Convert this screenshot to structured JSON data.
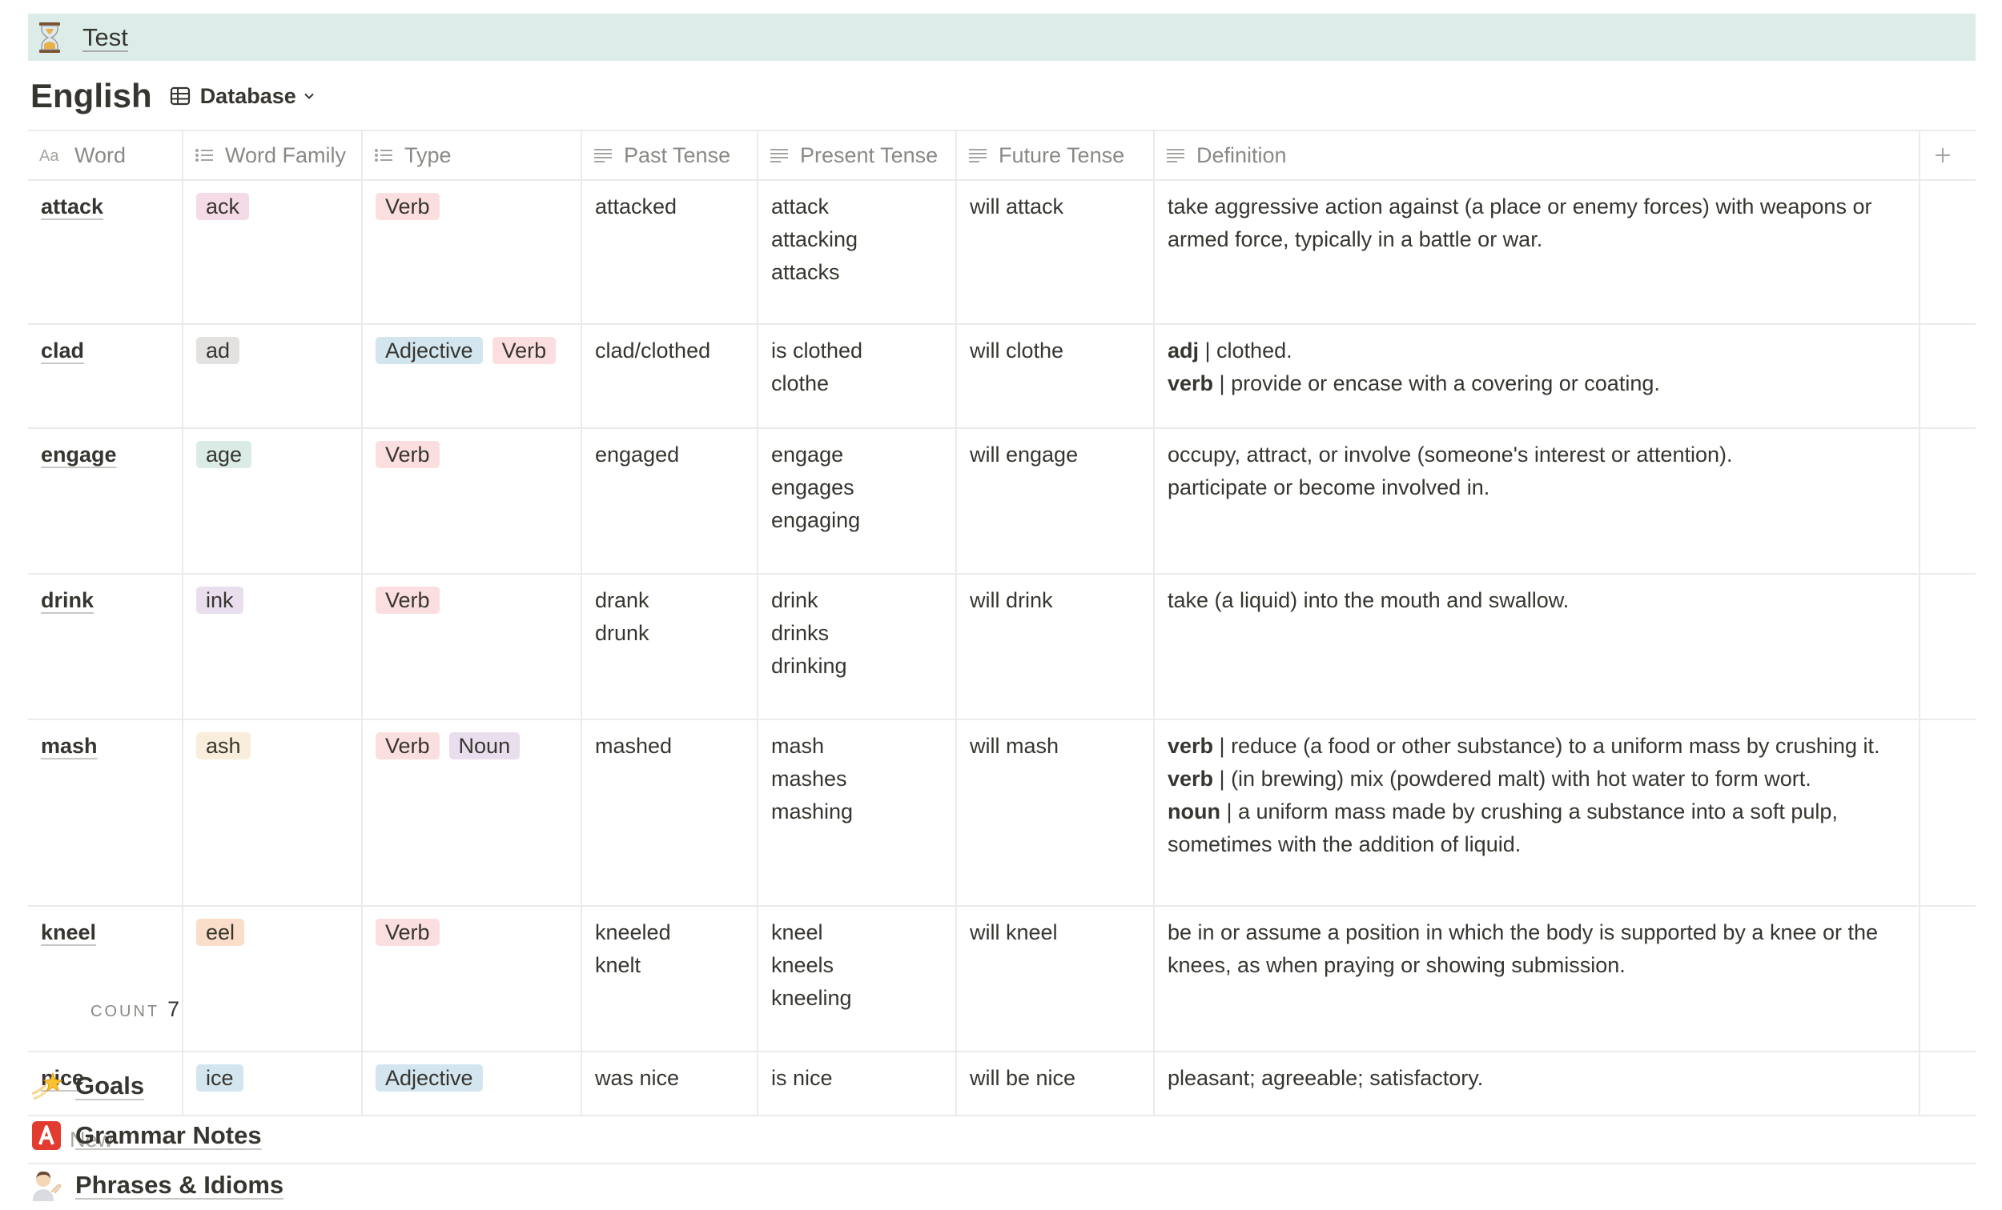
{
  "banner": {
    "title": "Test",
    "icon": "hourglass-icon"
  },
  "database": {
    "title": "English",
    "view_label": "Database"
  },
  "columns": [
    {
      "label": "Word",
      "icon": "title-icon"
    },
    {
      "label": "Word Family",
      "icon": "list-icon"
    },
    {
      "label": "Type",
      "icon": "list-icon"
    },
    {
      "label": "Past Tense",
      "icon": "text-icon"
    },
    {
      "label": "Present Tense",
      "icon": "text-icon"
    },
    {
      "label": "Future Tense",
      "icon": "text-icon"
    },
    {
      "label": "Definition",
      "icon": "text-icon"
    }
  ],
  "tag_colors": {
    "pink": "#f5dbe7",
    "gray": "#e3e2e0",
    "green": "#dbece6",
    "purple": "#e8deee",
    "yellow": "#f9eedc",
    "orange": "#fadec9",
    "blue": "#d3e5ef",
    "red": "#fbe4e4",
    "verb": "#fbdfe0",
    "adjective": "#d3e5ef",
    "noun": "#e8deee"
  },
  "rows": [
    {
      "word": "attack",
      "family": {
        "label": "ack",
        "color": "#f5dbe7"
      },
      "types": [
        {
          "label": "Verb",
          "color": "#fbdfe0"
        }
      ],
      "past": [
        "attacked"
      ],
      "present": [
        "attack",
        "attacking",
        "attacks"
      ],
      "future": [
        "will attack"
      ],
      "definition": [
        {
          "bold": "",
          "text": "take aggressive action against (a place or enemy forces) with weapons or"
        },
        {
          "bold": "",
          "text": "armed force, typically in a battle or war."
        }
      ]
    },
    {
      "word": "clad",
      "family": {
        "label": "ad",
        "color": "#e3e2e0"
      },
      "types": [
        {
          "label": "Adjective",
          "color": "#d3e5ef"
        },
        {
          "label": "Verb",
          "color": "#fbdfe0"
        }
      ],
      "past": [
        "clad/clothed"
      ],
      "present": [
        "is clothed",
        "clothe"
      ],
      "future": [
        "will clothe"
      ],
      "definition": [
        {
          "bold": "adj",
          "text": " | clothed."
        },
        {
          "bold": "verb",
          "text": " | provide or encase with a covering or coating."
        }
      ]
    },
    {
      "word": "engage",
      "family": {
        "label": "age",
        "color": "#dbece6"
      },
      "types": [
        {
          "label": "Verb",
          "color": "#fbdfe0"
        }
      ],
      "past": [
        "engaged"
      ],
      "present": [
        "engage",
        "engages",
        "engaging"
      ],
      "future": [
        "will engage"
      ],
      "definition": [
        {
          "bold": "",
          "text": "occupy, attract, or involve (someone's interest or attention)."
        },
        {
          "bold": "",
          "text": "participate or become involved in."
        }
      ]
    },
    {
      "word": "drink",
      "family": {
        "label": "ink",
        "color": "#e8deee"
      },
      "types": [
        {
          "label": "Verb",
          "color": "#fbdfe0"
        }
      ],
      "past": [
        "drank",
        "drunk"
      ],
      "present": [
        "drink",
        "drinks",
        "drinking"
      ],
      "future": [
        "will drink"
      ],
      "definition": [
        {
          "bold": "",
          "text": "take (a liquid) into the mouth and swallow."
        }
      ]
    },
    {
      "word": "mash",
      "family": {
        "label": "ash",
        "color": "#f9eedc"
      },
      "types": [
        {
          "label": "Verb",
          "color": "#fbdfe0"
        },
        {
          "label": "Noun",
          "color": "#e8deee"
        }
      ],
      "past": [
        "mashed"
      ],
      "present": [
        "mash",
        "mashes",
        "mashing"
      ],
      "future": [
        "will mash"
      ],
      "definition": [
        {
          "bold": "verb",
          "text": " | reduce (a food or other substance) to a uniform mass by crushing it."
        },
        {
          "bold": "verb",
          "text": " | (in brewing) mix (powdered malt) with hot water to form wort."
        },
        {
          "bold": "noun",
          "text": " | a uniform mass made by crushing a substance into a soft pulp,"
        },
        {
          "bold": "",
          "text": "sometimes with the addition of liquid."
        }
      ]
    },
    {
      "word": "kneel",
      "family": {
        "label": "eel",
        "color": "#fadec9"
      },
      "types": [
        {
          "label": "Verb",
          "color": "#fbdfe0"
        }
      ],
      "past": [
        "kneeled",
        "knelt"
      ],
      "present": [
        "kneel",
        "kneels",
        "kneeling"
      ],
      "future": [
        "will kneel"
      ],
      "definition": [
        {
          "bold": "",
          "text": "be in or assume a position in which the body is supported by a knee or the"
        },
        {
          "bold": "",
          "text": "knees, as when praying or showing submission."
        }
      ]
    },
    {
      "word": "nice",
      "family": {
        "label": "ice",
        "color": "#d3e5ef"
      },
      "types": [
        {
          "label": "Adjective",
          "color": "#d3e5ef"
        }
      ],
      "past": [
        "was nice"
      ],
      "present": [
        "is nice"
      ],
      "future": [
        "will be nice"
      ],
      "definition": [
        {
          "bold": "",
          "text": "pleasant; agreeable; satisfactory."
        }
      ]
    }
  ],
  "new_row_label": "New",
  "footer": {
    "count_label": "COUNT",
    "count_value": "7"
  },
  "pages": [
    {
      "label": "Goals",
      "icon": "shooting-star-icon"
    },
    {
      "label": "Grammar Notes",
      "icon": "letter-a-icon"
    },
    {
      "label": "Phrases & Idioms",
      "icon": "person-tipping-hand-icon"
    }
  ]
}
